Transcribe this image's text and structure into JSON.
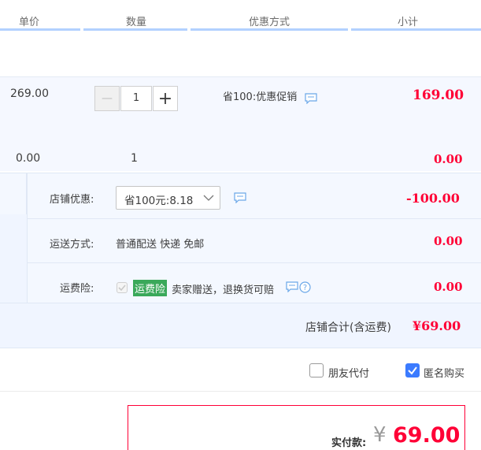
{
  "header": {
    "unit_price": "单价",
    "quantity": "数量",
    "discount": "优惠方式",
    "subtotal": "小计"
  },
  "item_main": {
    "price": "269.00",
    "quantity": "1",
    "minus": "—",
    "plus": "+",
    "promo": "省100:优惠促销",
    "subtotal": "169.00"
  },
  "item_gift": {
    "price": "0.00",
    "quantity": "1",
    "subtotal": "0.00"
  },
  "shop_discount": {
    "label": "店铺优惠:",
    "selected": "省100元:8.18",
    "amount": "-100.00"
  },
  "shipping": {
    "label": "运送方式:",
    "value": "普通配送 快递 免邮",
    "amount": "0.00"
  },
  "insurance": {
    "label": "运费险:",
    "badge": "运费险",
    "desc": "卖家赠送，退换货可赔",
    "amount": "0.00",
    "badge_color": "#3aa85a"
  },
  "shop_total": {
    "label": "店铺合计(含运费)",
    "amount": "¥69.00"
  },
  "options": {
    "friend_pay": "朋友代付",
    "anonymous": "匿名购买"
  },
  "payment": {
    "label": "实付款:",
    "currency": "¥",
    "amount": "69.00"
  },
  "colors": {
    "accent_red": "#ff0036",
    "header_line": "#b2d1ff",
    "band_bg": "#f2f7ff",
    "checkbox_blue": "#3b7bff"
  }
}
